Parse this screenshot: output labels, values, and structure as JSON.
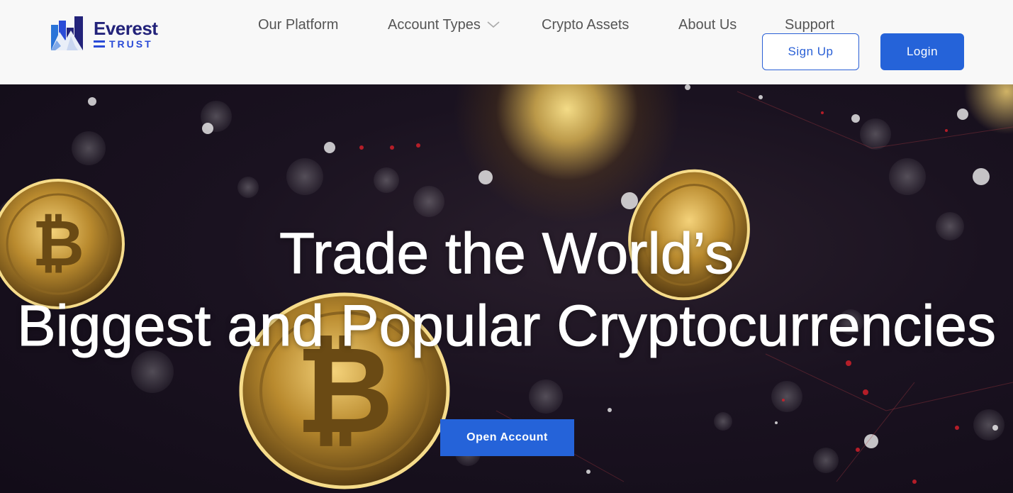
{
  "brand": {
    "name": "Everest",
    "tagline": "TRUST",
    "colors": {
      "primary": "#2563d9",
      "navy": "#23237a"
    }
  },
  "nav": {
    "items": [
      {
        "label": "Our Platform"
      },
      {
        "label": "Account Types",
        "icon": "chevron-down-icon"
      },
      {
        "label": "Crypto Assets"
      },
      {
        "label": "About Us"
      },
      {
        "label": "Support"
      }
    ]
  },
  "auth": {
    "signup_label": "Sign Up",
    "login_label": "Login"
  },
  "hero": {
    "line1": "Trade the World’s",
    "line2": "Biggest and Popular Cryptocurrencies",
    "cta_label": "Open Account",
    "background": "bitcoin-coins-image"
  }
}
